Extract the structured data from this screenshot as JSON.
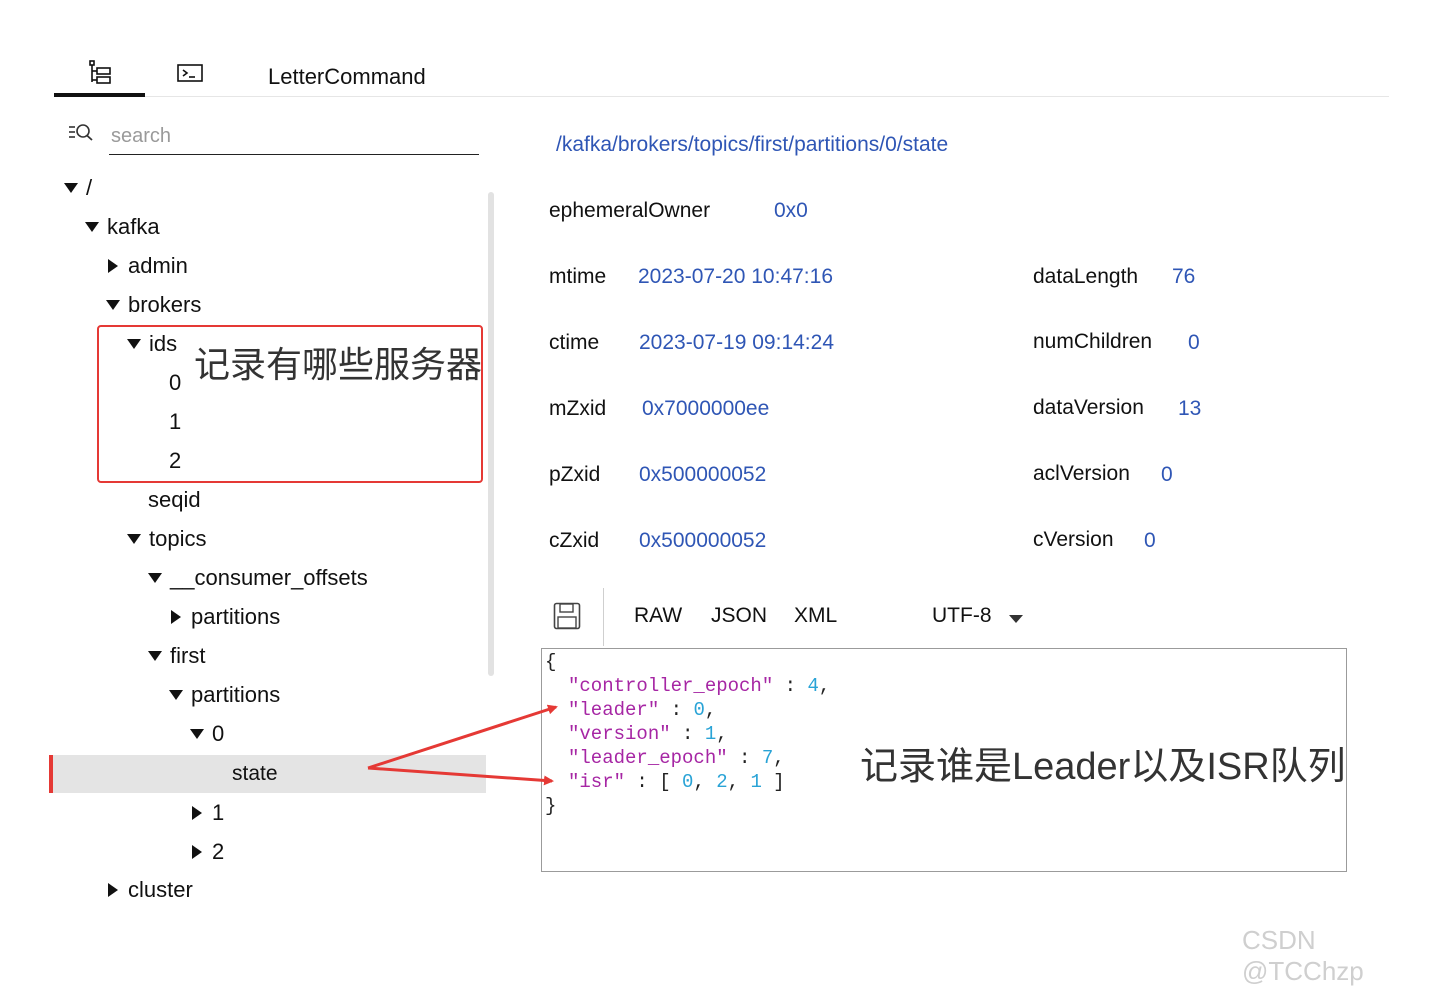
{
  "tabs": {
    "tree_icon": "tree-structure-icon",
    "terminal_icon": "terminal-icon",
    "command_label": "LetterCommand"
  },
  "search": {
    "icon": "search-filter-icon",
    "placeholder": "search"
  },
  "tree": {
    "root": "/",
    "kafka": "kafka",
    "admin": "admin",
    "brokers": "brokers",
    "ids": "ids",
    "id0": "0",
    "id1": "1",
    "id2": "2",
    "seqid": "seqid",
    "topics": "topics",
    "consumer_offsets": "__consumer_offsets",
    "consumer_partitions": "partitions",
    "first": "first",
    "first_partitions": "partitions",
    "p0": "0",
    "state": "state",
    "p1": "1",
    "p2": "2",
    "cluster": "cluster"
  },
  "annotations": {
    "ids_note": "记录有哪些服务器",
    "state_note": "记录谁是Leader以及ISR队列",
    "arrow_color": "#e53935"
  },
  "node": {
    "path": "/kafka/brokers/topics/first/partitions/0/state",
    "stat": {
      "ephemeralOwner_label": "ephemeralOwner",
      "ephemeralOwner": "0x0",
      "mtime_label": "mtime",
      "mtime": "2023-07-20 10:47:16",
      "ctime_label": "ctime",
      "ctime": "2023-07-19 09:14:24",
      "mZxid_label": "mZxid",
      "mZxid": "0x7000000ee",
      "pZxid_label": "pZxid",
      "pZxid": "0x500000052",
      "cZxid_label": "cZxid",
      "cZxid": "0x500000052",
      "dataLength_label": "dataLength",
      "dataLength": "76",
      "numChildren_label": "numChildren",
      "numChildren": "0",
      "dataVersion_label": "dataVersion",
      "dataVersion": "13",
      "aclVersion_label": "aclVersion",
      "aclVersion": "0",
      "cVersion_label": "cVersion",
      "cVersion": "0"
    }
  },
  "viewer": {
    "save_icon": "save-icon",
    "raw": "RAW",
    "json": "JSON",
    "xml": "XML",
    "encoding": "UTF-8"
  },
  "json_content": {
    "open": "{",
    "close": "}",
    "k_controller_epoch": "\"controller_epoch\"",
    "v_controller_epoch": "4",
    "k_leader": "\"leader\"",
    "v_leader": "0",
    "k_version": "\"version\"",
    "v_version": "1",
    "k_leader_epoch": "\"leader_epoch\"",
    "v_leader_epoch": "7",
    "k_isr": "\"isr\"",
    "isr": [
      "0",
      "2",
      "1"
    ]
  },
  "colors": {
    "link_blue": "#2f56b5",
    "json_key": "#a626a4",
    "json_number": "#29a3d6",
    "highlight_red": "#e53935"
  },
  "watermark": "CSDN @TCChzp"
}
